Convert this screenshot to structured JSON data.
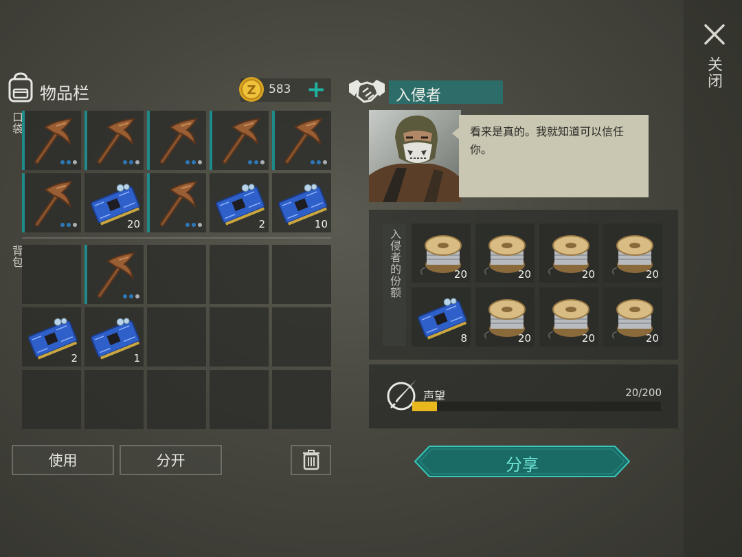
{
  "close": {
    "label": "关闭"
  },
  "inventory": {
    "title": "物品栏",
    "coins": "583",
    "pocket_label": "口袋",
    "backpack_label": "背包"
  },
  "pocket_slots": [
    {
      "item": "pickaxe",
      "dots": [
        1,
        1,
        0
      ]
    },
    {
      "item": "pickaxe",
      "dots": [
        1,
        1,
        0
      ]
    },
    {
      "item": "pickaxe",
      "dots": [
        1,
        1,
        0
      ]
    },
    {
      "item": "pickaxe",
      "dots": [
        1,
        1,
        0
      ]
    },
    {
      "item": "pickaxe",
      "dots": [
        1,
        1,
        0
      ]
    },
    {
      "item": "pickaxe",
      "dots": [
        1,
        1,
        0
      ]
    },
    {
      "item": "circuit-board",
      "count": "20"
    },
    {
      "item": "pickaxe",
      "dots": [
        1,
        1,
        0
      ]
    },
    {
      "item": "circuit-board",
      "count": "2"
    },
    {
      "item": "circuit-board",
      "count": "10"
    }
  ],
  "backpack_slots": [
    {
      "item": ""
    },
    {
      "item": "pickaxe",
      "dots": [
        1,
        1,
        0
      ]
    },
    {
      "item": ""
    },
    {
      "item": ""
    },
    {
      "item": ""
    },
    {
      "item": "circuit-board",
      "count": "2"
    },
    {
      "item": "circuit-board",
      "count": "1"
    },
    {
      "item": ""
    },
    {
      "item": ""
    },
    {
      "item": ""
    },
    {
      "item": ""
    },
    {
      "item": ""
    },
    {
      "item": ""
    },
    {
      "item": ""
    },
    {
      "item": ""
    }
  ],
  "actions": {
    "use_label": "使用",
    "split_label": "分开"
  },
  "trader": {
    "name": "入侵者",
    "dialogue": "看来是真的。我就知道可以信任你。",
    "offer_label": "入侵者的份额",
    "offer_slots": [
      {
        "item": "wire-spool",
        "count": "20"
      },
      {
        "item": "wire-spool",
        "count": "20"
      },
      {
        "item": "wire-spool",
        "count": "20"
      },
      {
        "item": "wire-spool",
        "count": "20"
      },
      {
        "item": "circuit-board",
        "count": "8"
      },
      {
        "item": "wire-spool",
        "count": "20"
      },
      {
        "item": "wire-spool",
        "count": "20"
      },
      {
        "item": "wire-spool",
        "count": "20"
      }
    ]
  },
  "reputation": {
    "label": "声望",
    "value": "20/200",
    "current": 20,
    "max": 200
  },
  "share_button": {
    "label": "分享"
  },
  "colors": {
    "accent_teal": "#1fb3a3",
    "slot_bar": "#1e8a8a",
    "rep_fill": "#e8b81e",
    "durability_dot": "#2e78b8"
  },
  "icons": [
    "close-icon",
    "backpack-icon",
    "coin-icon",
    "handshake-icon",
    "trash-icon",
    "knife-icon"
  ]
}
